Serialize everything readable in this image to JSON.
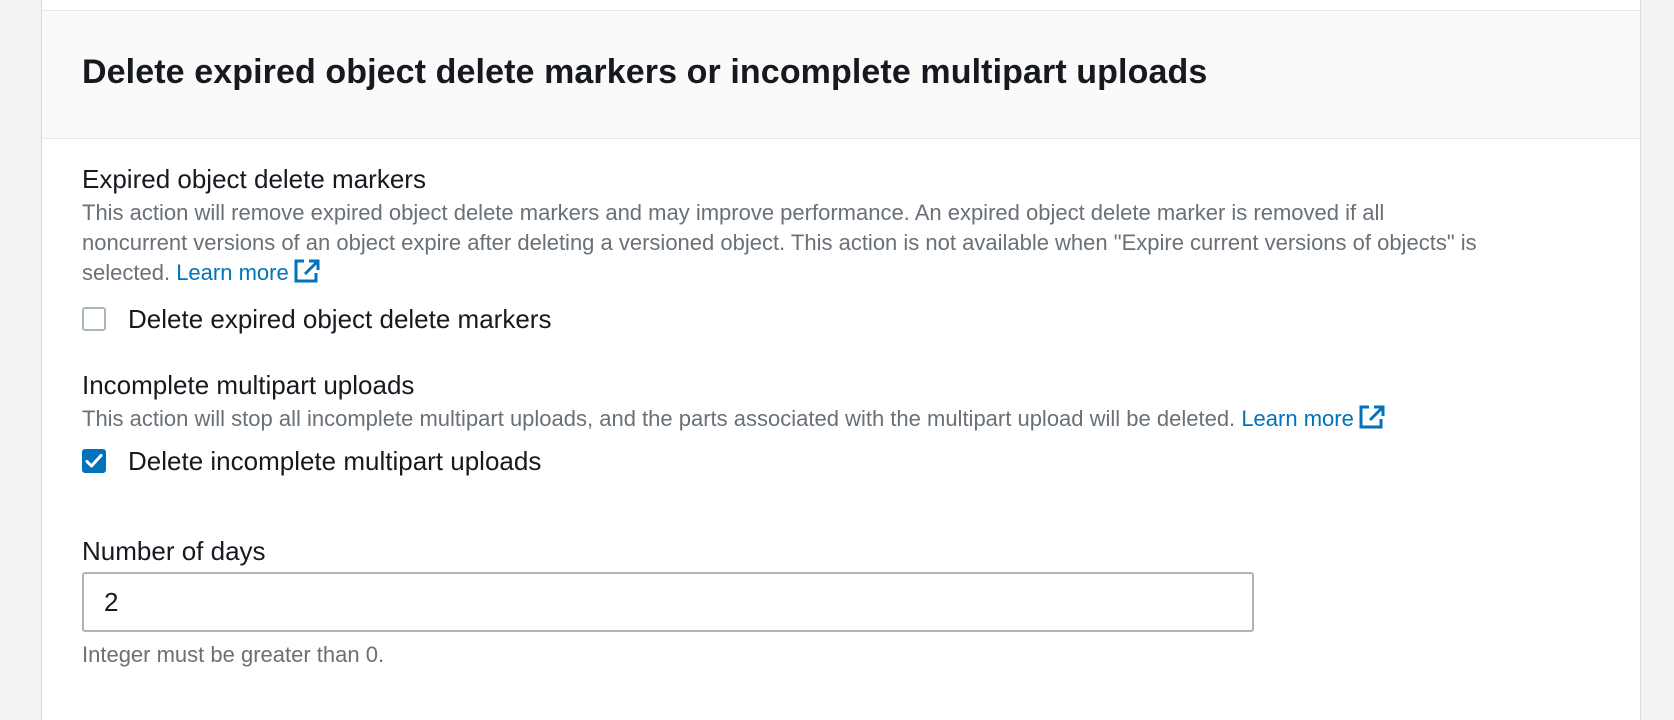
{
  "panel": {
    "title": "Delete expired object delete markers or incomplete multipart uploads"
  },
  "expired_markers": {
    "label": "Expired object delete markers",
    "description": "This action will remove expired object delete markers and may improve performance. An expired object delete marker is removed if all noncurrent versions of an object expire after deleting a versioned object. This action is not available when \"Expire current versions of objects\" is selected.",
    "learn_more": "Learn more",
    "checkbox_label": "Delete expired object delete markers",
    "checked": false
  },
  "incomplete_uploads": {
    "label": "Incomplete multipart uploads",
    "description": "This action will stop all incomplete multipart uploads, and the parts associated with the multipart upload will be deleted.",
    "learn_more": "Learn more",
    "checkbox_label": "Delete incomplete multipart uploads",
    "checked": true
  },
  "days": {
    "label": "Number of days",
    "value": "2",
    "hint": "Integer must be greater than 0."
  },
  "colors": {
    "accent": "#0073bb",
    "muted_text": "#687078",
    "header_bg": "#fafafa",
    "page_bg": "#f2f3f3"
  },
  "icons": {
    "external_link": "external-link-icon",
    "checkmark": "checkmark-icon"
  }
}
